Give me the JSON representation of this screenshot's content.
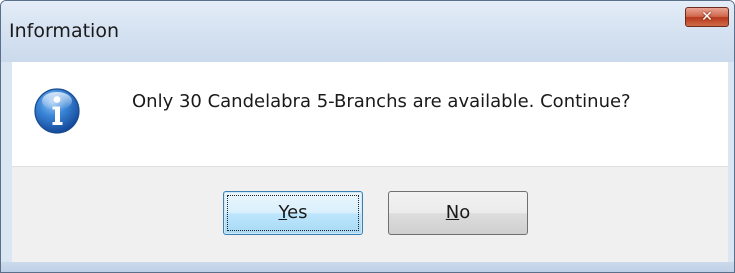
{
  "window": {
    "title": "Information",
    "close_glyph": "✕"
  },
  "message": {
    "icon": "information-icon",
    "text": "Only 30 Candelabra 5-Branchs are available. Continue?"
  },
  "buttons": {
    "yes": {
      "mnemonic": "Y",
      "rest": "es"
    },
    "no": {
      "mnemonic": "N",
      "rest": "o"
    }
  },
  "colors": {
    "frame": "#dbe6f3",
    "close_button": "#c9482b",
    "default_button": "#bee6fd",
    "info_icon": "#1f5fb5"
  }
}
